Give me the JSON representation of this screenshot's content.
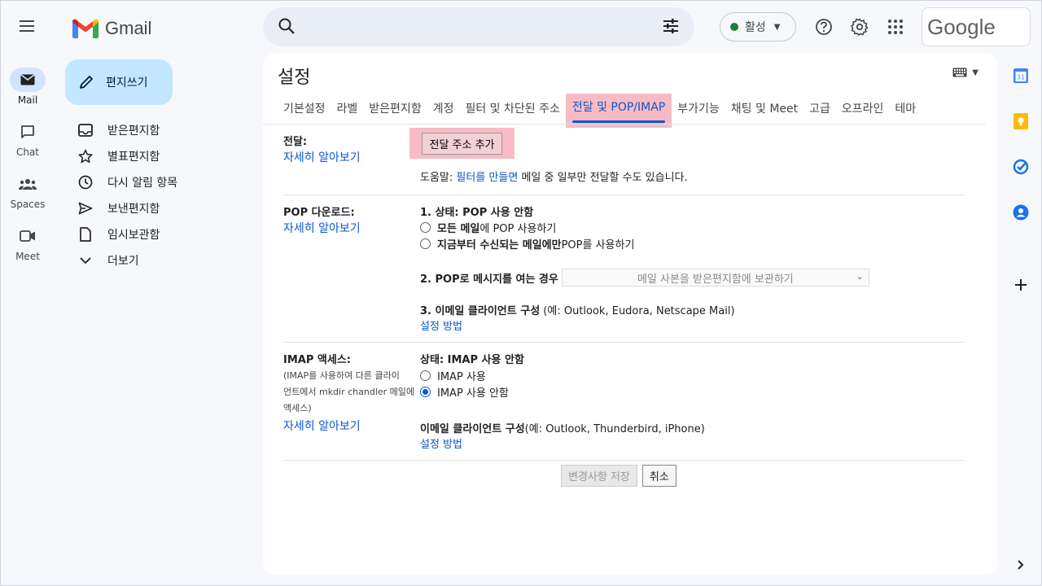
{
  "rail": {
    "mail": "Mail",
    "chat": "Chat",
    "spaces": "Spaces",
    "meet": "Meet"
  },
  "logo": {
    "text": "Gmail"
  },
  "compose": {
    "label": "편지쓰기"
  },
  "nav": [
    {
      "label": "받은편지함",
      "icon": "inbox-icon"
    },
    {
      "label": "별표편지함",
      "icon": "star-icon"
    },
    {
      "label": "다시 알림 항목",
      "icon": "clock-icon"
    },
    {
      "label": "보낸편지함",
      "icon": "send-icon"
    },
    {
      "label": "임시보관함",
      "icon": "draft-icon"
    },
    {
      "label": "더보기",
      "icon": "chevron-down-icon"
    }
  ],
  "search": {
    "placeholder": ""
  },
  "status": {
    "label": "활성"
  },
  "google": {
    "text": "Google"
  },
  "settings": {
    "title": "설정",
    "tabs": [
      "기본설정",
      "라벨",
      "받은편지함",
      "계정",
      "필터 및 차단된 주소",
      "전달 및 POP/IMAP",
      "부가기능",
      "채팅 및 Meet",
      "고급",
      "오프라인",
      "테마"
    ],
    "forwarding": {
      "label": "전달:",
      "learn": "자세히 알아보기",
      "add_button": "전달 주소 추가",
      "tip_prefix": "도움말: ",
      "tip_link": "필터를 만들면",
      "tip_suffix": " 메일 중 일부만 전달할 수도 있습니다."
    },
    "pop": {
      "label": "POP 다운로드:",
      "learn": "자세히 알아보기",
      "status": "1. 상태: POP 사용 안함",
      "opt1_bold": "모든 메일",
      "opt1_rest": "에 POP 사용하기",
      "opt2_bold": "지금부터 수신되는 메일에만",
      "opt2_rest": " POP를 사용하기",
      "when_label": "2. POP로 메시지를 여는 경우",
      "when_select": "메일 사본을 받은편지함에 보관하기",
      "client_bold": "3. 이메일 클라이언트 구성",
      "client_rest": " (예: Outlook, Eudora, Netscape Mail)",
      "howto": "설정 방법"
    },
    "imap": {
      "label": "IMAP 액세스:",
      "note1": "(IMAP를 사용하여 다른 클라이",
      "note2": "언트에서 mkdir chandler 메일에",
      "note3": "액세스)",
      "learn": "자세히 알아보기",
      "status": "상태: IMAP 사용 안함",
      "opt_on": "IMAP 사용",
      "opt_off": "IMAP 사용 안함",
      "client_bold": "이메일 클라이언트 구성",
      "client_rest": "(예: Outlook, Thunderbird, iPhone)",
      "howto": "설정 방법"
    },
    "save": "변경사항 저장",
    "cancel": "취소"
  }
}
